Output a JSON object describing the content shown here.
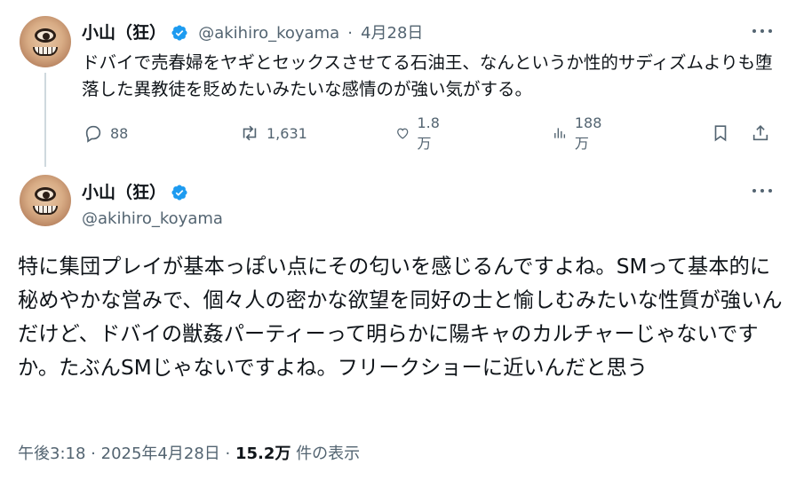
{
  "tweet1": {
    "display_name": "小山（狂）",
    "handle": "@akihiro_koyama",
    "separator": "·",
    "date": "4月28日",
    "text": "ドバイで売春婦をヤギとセックスさせてる石油王、なんというか性的サディズムよりも堕落した異教徒を貶めたいみたいな感情のが強い気がする。",
    "actions": {
      "replies": "88",
      "retweets": "1,631",
      "likes": "1.8万",
      "views": "188万"
    }
  },
  "tweet2": {
    "display_name": "小山（狂）",
    "handle": "@akihiro_koyama",
    "text": "特に集団プレイが基本っぽい点にその匂いを感じるんですよね。SMって基本的に秘めやかな営みで、個々人の密かな欲望を同好の士と愉しむみたいな性質が強いんだけど、ドバイの獣姦パーティーって明らかに陽キャのカルチャーじゃないですか。たぶんSMじゃないですよね。フリークショーに近いんだと思う",
    "time": "午後3:18",
    "separator": "·",
    "date": "2025年4月28日",
    "views_count": "15.2万",
    "views_label": "件の表示"
  },
  "colors": {
    "text_primary": "#0f1419",
    "text_secondary": "#536471",
    "verified_blue": "#1d9bf0",
    "thread_line": "#cfd9de"
  },
  "icons": [
    "verified-badge-icon",
    "more-icon",
    "reply-icon",
    "retweet-icon",
    "like-icon",
    "views-icon",
    "bookmark-icon",
    "share-icon"
  ]
}
